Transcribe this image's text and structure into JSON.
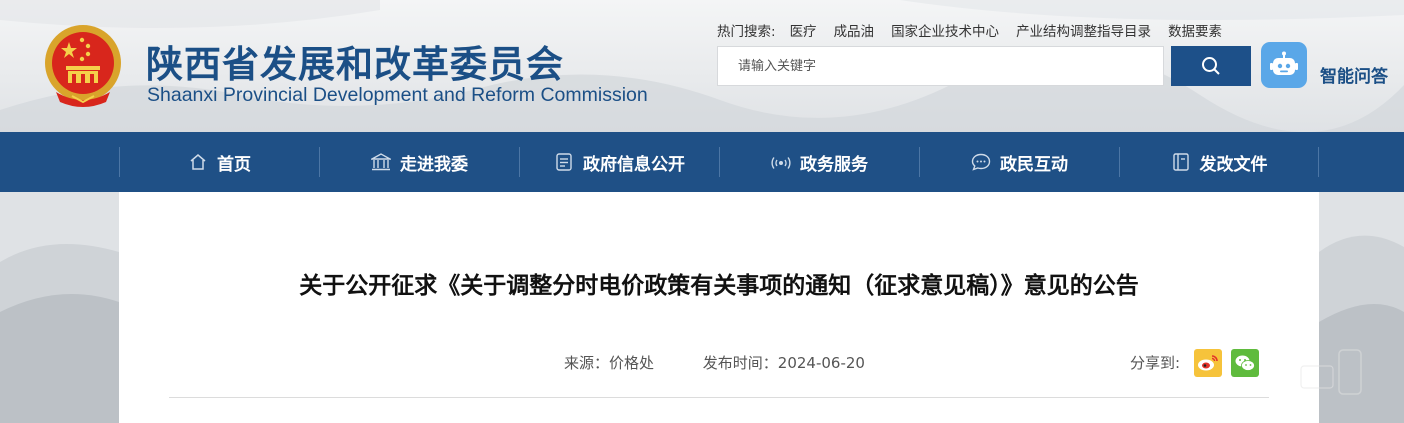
{
  "header": {
    "title_cn": "陕西省发展和改革委员会",
    "title_en": "Shaanxi Provincial Development and Reform Commission",
    "emblem_icon": "national-emblem-icon"
  },
  "hot_search": {
    "label": "热门搜索:",
    "items": [
      "医疗",
      "成品油",
      "国家企业技术中心",
      "产业结构调整指导目录",
      "数据要素"
    ]
  },
  "search": {
    "placeholder": "请输入关键字",
    "button_icon": "search-icon"
  },
  "assistant": {
    "label": "智能问答",
    "icon": "robot-icon"
  },
  "nav": {
    "items": [
      {
        "label": "首页",
        "icon": "home-icon"
      },
      {
        "label": "走进我委",
        "icon": "building-icon"
      },
      {
        "label": "政府信息公开",
        "icon": "document-icon"
      },
      {
        "label": "政务服务",
        "icon": "signal-icon"
      },
      {
        "label": "政民互动",
        "icon": "chat-icon"
      },
      {
        "label": "发改文件",
        "icon": "file-icon"
      }
    ]
  },
  "article": {
    "title": "关于公开征求《关于调整分时电价政策有关事项的通知（征求意见稿）》意见的公告",
    "source": "来源：价格处",
    "publish_time": "发布时间：2024-06-20",
    "share_label": "分享到:",
    "share_icons": [
      "weibo-icon",
      "wechat-icon"
    ]
  },
  "colors": {
    "brand_blue": "#1b4f86",
    "nav_blue": "#1f5086",
    "robot_blue": "#5aa7e8",
    "weibo_yellow": "#f6c33b",
    "wechat_green": "#5fbb3d"
  }
}
